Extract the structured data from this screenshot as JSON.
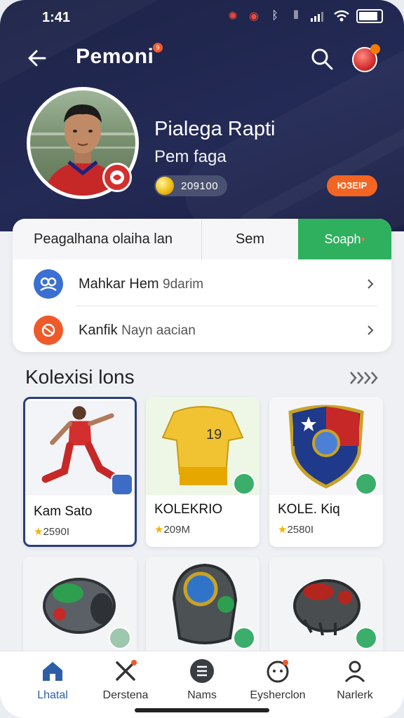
{
  "status_bar": {
    "time": "1:41",
    "icons": [
      "gear-icon",
      "alarm-icon",
      "bluetooth-icon",
      "vibrate-icon",
      "signal-icon",
      "wifi-icon",
      "battery-icon"
    ]
  },
  "header": {
    "title": "Pemoni",
    "badge_count": "9"
  },
  "profile": {
    "name": "Pialega Rapti",
    "subtitle": "Pem faga",
    "coins": "209100",
    "action_label": "ЮЗЕІР"
  },
  "tabs": [
    {
      "label": "Peagalhana olaiha lan"
    },
    {
      "label": "Sem"
    },
    {
      "label": "Soaph"
    }
  ],
  "rows": [
    {
      "title": "Mahkar Hem",
      "sub": "9darim"
    },
    {
      "title": "Kanfik",
      "sub": "Nayn aacian"
    }
  ],
  "collections": {
    "title": "Kolexisi lons",
    "items": [
      {
        "name": "Kam Sato",
        "price": "2590I"
      },
      {
        "name": "KOLEKRIO",
        "price": "209M"
      },
      {
        "name": "KOLE. Kiq",
        "price": "2580I"
      },
      {
        "name": "",
        "price": ""
      },
      {
        "name": "",
        "price": ""
      },
      {
        "name": "",
        "price": ""
      }
    ]
  },
  "bottom_nav": [
    {
      "label": "Lhatal",
      "icon": "home-icon"
    },
    {
      "label": "Derstena",
      "icon": "tools-icon"
    },
    {
      "label": "Nams",
      "icon": "list-icon"
    },
    {
      "label": "Eysherclon",
      "icon": "face-icon"
    },
    {
      "label": "Narlerk",
      "icon": "profile-icon"
    }
  ],
  "colors": {
    "header_bg": "#1f2550",
    "accent_green": "#2fb05e",
    "accent_orange": "#f26522",
    "active_nav": "#2c5fa8"
  }
}
